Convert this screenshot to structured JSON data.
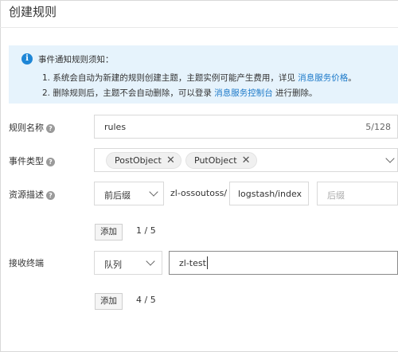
{
  "dialog": {
    "title": "创建规则"
  },
  "notice": {
    "title": "事件通知规则须知：",
    "line1_prefix": "1. 系统会自动为新建的规则创建主题，主题实例可能产生费用，详见",
    "line1_link": "消息服务价格",
    "line1_suffix": "。",
    "line2_prefix": "2. 删除规则后，主题不会自动删除，可以登录",
    "line2_link": "消息服务控制台",
    "line2_suffix": "进行删除。"
  },
  "form": {
    "rule_name": {
      "label": "规则名称",
      "value": "rules",
      "counter": "5/128"
    },
    "event_type": {
      "label": "事件类型",
      "tags": [
        "PostObject",
        "PutObject"
      ]
    },
    "resource": {
      "label": "资源描述",
      "prefix_select": "前后缀",
      "bucket_prefix": "zl-ossoutoss/",
      "prefix_value": "logstash/index",
      "suffix_placeholder": "后缀",
      "add_button": "添加",
      "count": "1 / 5"
    },
    "endpoint": {
      "label": "接收终端",
      "type_select": "队列",
      "value": "zl-test",
      "add_button": "添加",
      "count": "4 / 5"
    }
  }
}
